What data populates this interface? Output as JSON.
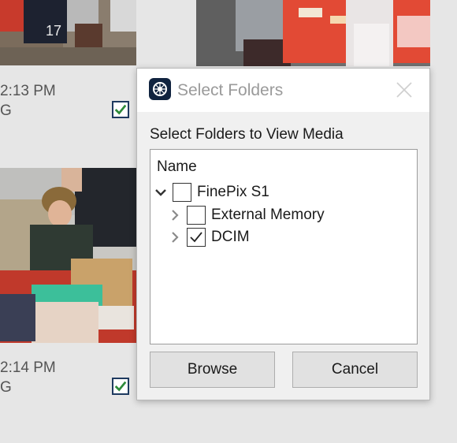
{
  "gallery": {
    "items": [
      {
        "time": "2:13 PM",
        "ext": "G",
        "selected": true
      },
      {
        "time": "2:14 PM",
        "ext": "G",
        "selected": true
      }
    ]
  },
  "dialog": {
    "title": "Select Folders",
    "prompt": "Select Folders to View Media",
    "column_header": "Name",
    "tree": [
      {
        "label": "FinePix S1",
        "expanded": true,
        "checked": false
      },
      {
        "label": "External Memory",
        "expanded": false,
        "checked": false
      },
      {
        "label": "DCIM",
        "expanded": false,
        "checked": true
      }
    ],
    "browse_label": "Browse",
    "cancel_label": "Cancel"
  },
  "colors": {
    "checkbox_check": "#2e8b3a",
    "checkbox_border": "#1e3a5f",
    "title_text": "#9a9a9a",
    "app_icon_bg": "#10233f"
  },
  "icons": [
    "checkmark-icon",
    "app-logo-icon",
    "close-icon",
    "chevron-down-icon",
    "chevron-right-icon"
  ]
}
